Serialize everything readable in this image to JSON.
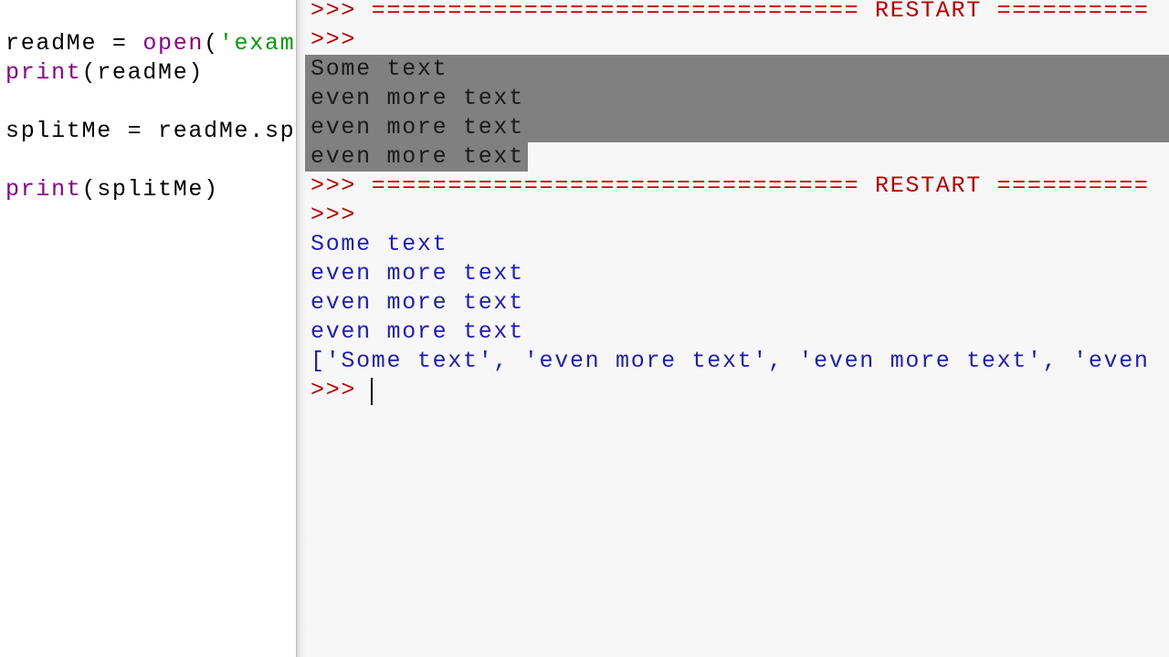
{
  "editor": {
    "lines": [
      {
        "parts": [
          "readMe = ",
          "open",
          "(",
          "'exam"
        ]
      },
      {
        "parts": [
          "print",
          "(readMe)"
        ]
      },
      {
        "parts": [
          "splitMe = readMe.sp"
        ]
      },
      {
        "parts": [
          "print",
          "(splitMe)"
        ]
      }
    ]
  },
  "shell": {
    "prompt": ">>>",
    "restart_lines": [
      ">>> ================================ RESTART ==========",
      ">>> ================================ RESTART =========="
    ],
    "prompt_lines": [
      ">>>",
      ">>>",
      ">>> "
    ],
    "first_run_output": [
      "Some text",
      "even more text",
      "even more text",
      "even more text"
    ],
    "second_run_output": [
      "Some text",
      "even more text",
      "even more text",
      "even more text"
    ],
    "list_output": "['Some text', 'even more text', 'even more text', 'even"
  },
  "colors": {
    "prompt": "#c00000",
    "output": "#1d1dbd",
    "builtin": "#900090",
    "string": "#00a000",
    "selection": "#808080"
  }
}
